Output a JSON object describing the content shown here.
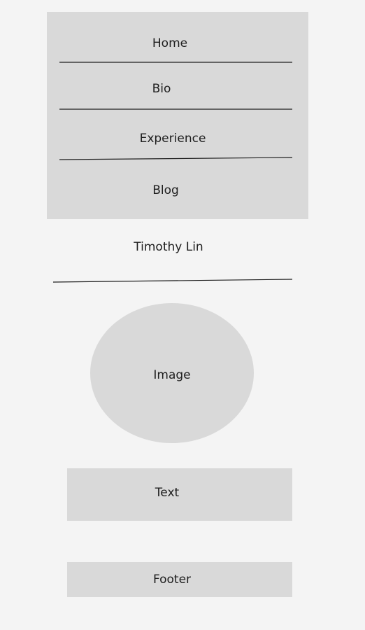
{
  "nav": {
    "items": [
      {
        "label": "Home"
      },
      {
        "label": "Bio"
      },
      {
        "label": "Experience"
      },
      {
        "label": "Blog"
      }
    ]
  },
  "header": {
    "name": "Timothy Lin"
  },
  "image": {
    "label": "Image"
  },
  "text_block": {
    "label": "Text"
  },
  "footer": {
    "label": "Footer"
  },
  "colors": {
    "background": "#f4f4f4",
    "placeholder": "#d9d9d9",
    "stroke": "#1e1e1e"
  }
}
